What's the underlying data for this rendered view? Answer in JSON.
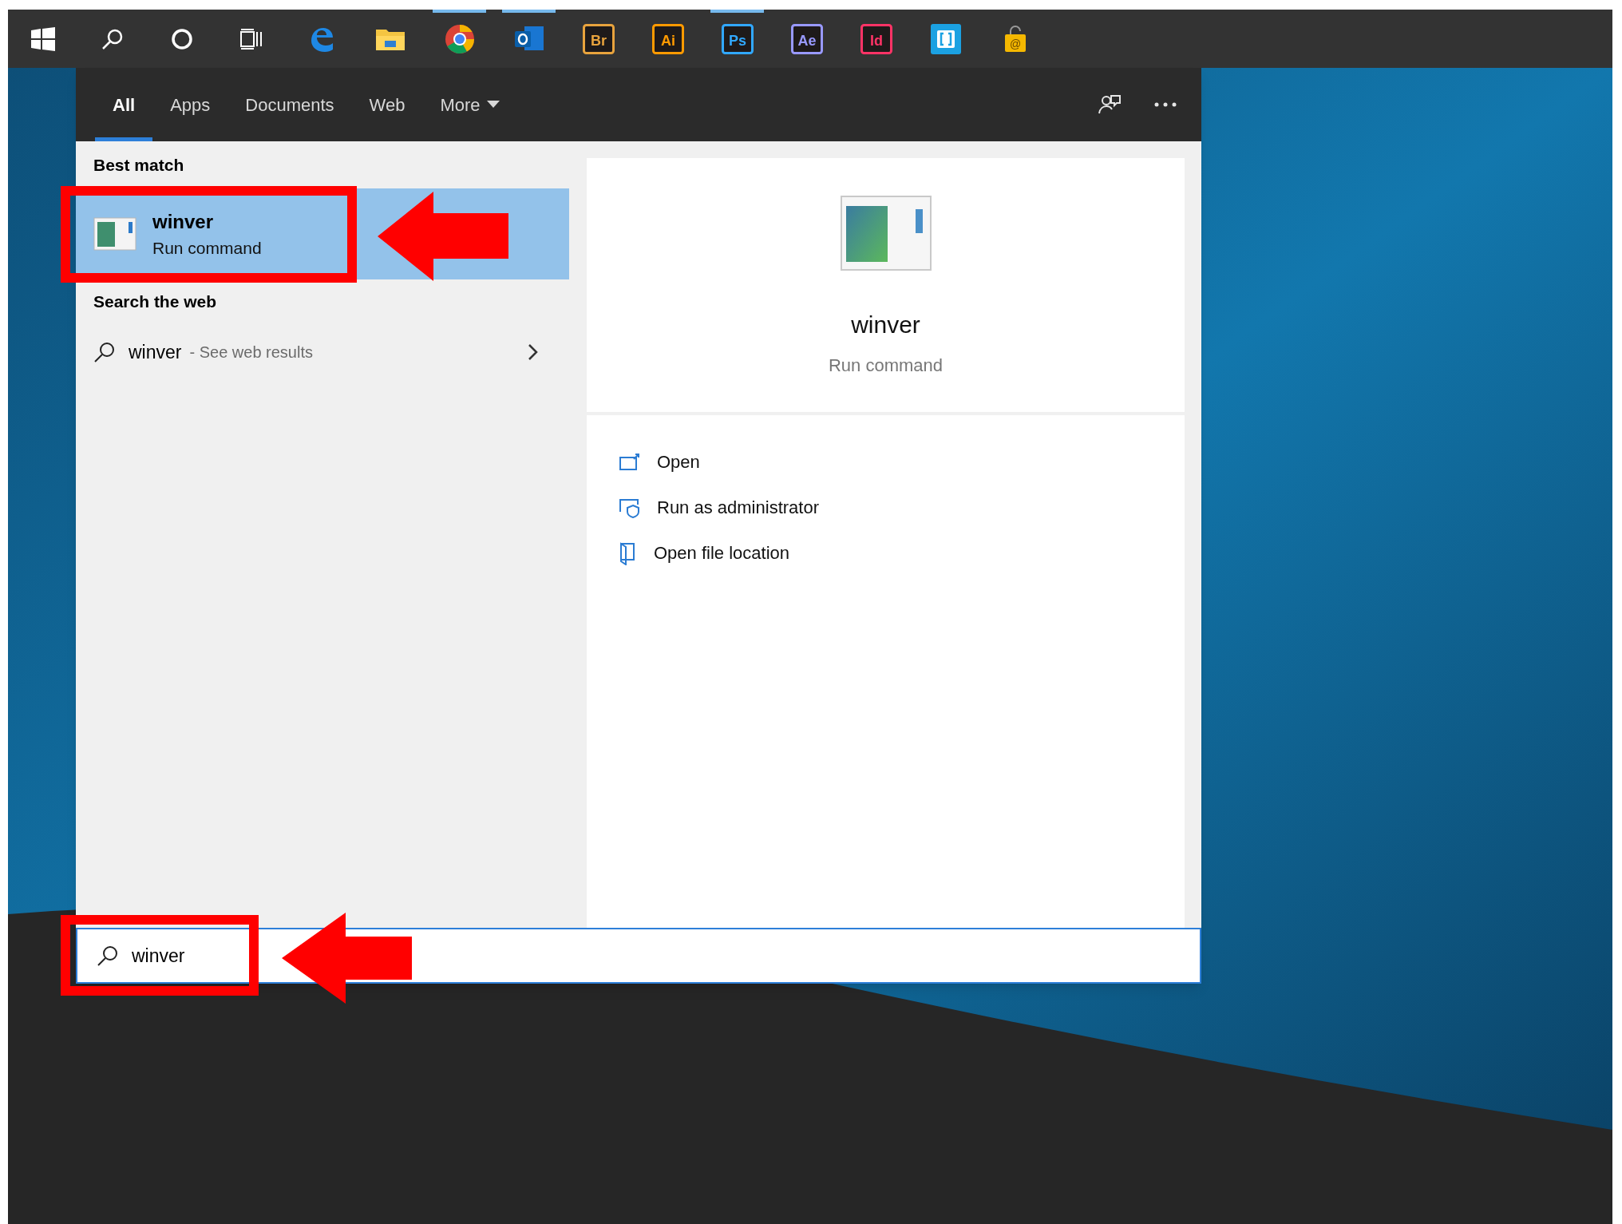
{
  "taskbar": {
    "items": [
      {
        "kind": "start",
        "running": false
      },
      {
        "kind": "search",
        "running": false
      },
      {
        "kind": "cortana",
        "running": false
      },
      {
        "kind": "taskview",
        "running": false
      },
      {
        "kind": "edge",
        "running": false
      },
      {
        "kind": "explorer",
        "running": false
      },
      {
        "kind": "chrome",
        "running": true
      },
      {
        "kind": "outlook",
        "running": true
      },
      {
        "kind": "adobe",
        "label": "Br",
        "color": "#e8a33d",
        "running": false
      },
      {
        "kind": "adobe",
        "label": "Ai",
        "color": "#ff9a00",
        "running": false
      },
      {
        "kind": "adobe",
        "label": "Ps",
        "color": "#31a8ff",
        "running": true
      },
      {
        "kind": "adobe",
        "label": "Ae",
        "color": "#9999ff",
        "running": false
      },
      {
        "kind": "adobe",
        "label": "Id",
        "color": "#ff3366",
        "running": false
      },
      {
        "kind": "bracket",
        "running": false
      },
      {
        "kind": "lock",
        "label": "@",
        "running": false
      }
    ]
  },
  "search_panel": {
    "tabs": [
      {
        "label": "All",
        "selected": true,
        "dropdown": false
      },
      {
        "label": "Apps",
        "selected": false,
        "dropdown": false
      },
      {
        "label": "Documents",
        "selected": false,
        "dropdown": false
      },
      {
        "label": "Web",
        "selected": false,
        "dropdown": false
      },
      {
        "label": "More",
        "selected": false,
        "dropdown": true
      }
    ],
    "best_match": {
      "heading": "Best match",
      "item": {
        "title": "winver",
        "subtitle": "Run command",
        "selected": true
      }
    },
    "web": {
      "heading": "Search the web",
      "query": "winver",
      "suffix": "- See web results"
    },
    "preview": {
      "title": "winver",
      "subtitle": "Run command",
      "actions": [
        {
          "kind": "open",
          "label": "Open"
        },
        {
          "kind": "admin",
          "label": "Run as administrator"
        },
        {
          "kind": "location",
          "label": "Open file location"
        }
      ]
    },
    "search_box": {
      "value": "winver"
    }
  }
}
